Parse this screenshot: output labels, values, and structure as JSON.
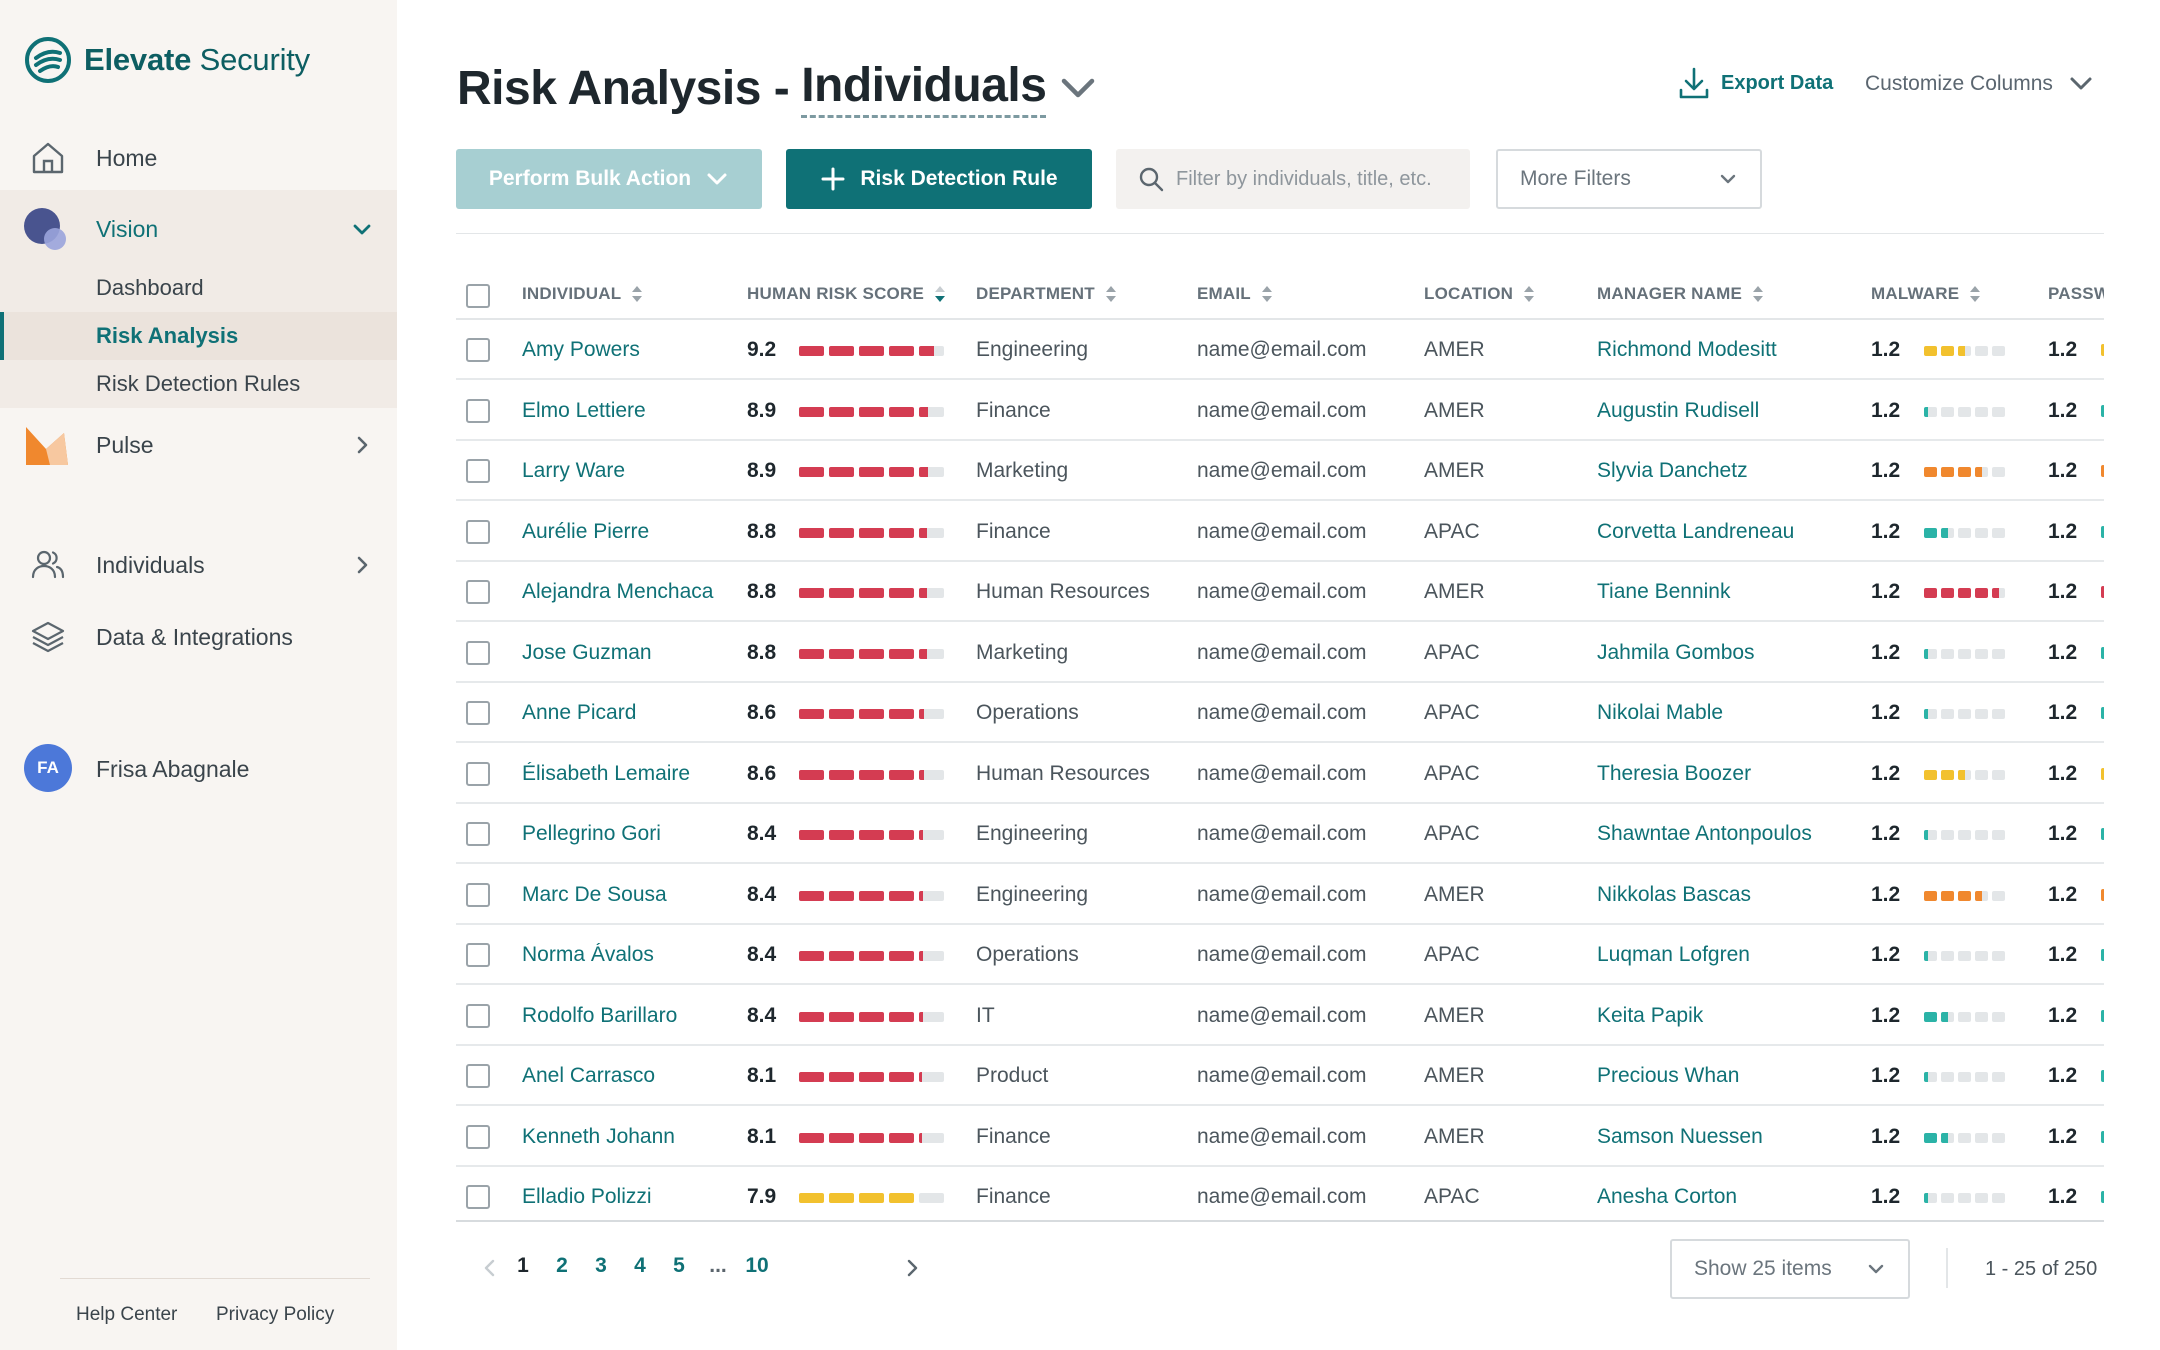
{
  "brand": {
    "name_bold": "Elevate",
    "name_light": " Security"
  },
  "nav": {
    "home": "Home",
    "vision": "Vision",
    "vision_sub": [
      "Dashboard",
      "Risk Analysis",
      "Risk Detection Rules"
    ],
    "pulse": "Pulse",
    "individuals": "Individuals",
    "data_integrations": "Data & Integrations"
  },
  "user": {
    "initials": "FA",
    "name": "Frisa Abagnale"
  },
  "footer": {
    "help": "Help Center",
    "privacy": "Privacy Policy"
  },
  "page": {
    "title_prefix": "Risk Analysis -",
    "title_selector": "Individuals"
  },
  "toolbar": {
    "export": "Export Data",
    "customize": "Customize Columns",
    "bulk": "Perform Bulk Action",
    "rule": "Risk Detection Rule",
    "search_placeholder": "Filter by individuals, title, etc.",
    "more_filters": "More Filters"
  },
  "colors": {
    "accent": "#0f7176",
    "risk_red": "#d43c52",
    "risk_yellow": "#f2c12e",
    "orange": "#f0882e",
    "teal": "#2bb3a7",
    "track": "#e3e6e8"
  },
  "table": {
    "columns": [
      "INDIVIDUAL",
      "HUMAN RISK SCORE",
      "DEPARTMENT",
      "EMAIL",
      "LOCATION",
      "MANAGER NAME",
      "MALWARE",
      "PASSW"
    ],
    "rows": [
      {
        "name": "Amy Powers",
        "score": "9.2",
        "risk": 0.92,
        "dept": "Engineering",
        "email": "name@email.com",
        "loc": "AMER",
        "mgr": "Richmond Modesitt",
        "mal": "1.2",
        "mal_level": 0.5,
        "mal_color": "yellow",
        "pw": "1.2"
      },
      {
        "name": "Elmo Lettiere",
        "score": "8.9",
        "risk": 0.87,
        "dept": "Finance",
        "email": "name@email.com",
        "loc": "AMER",
        "mgr": "Augustin Rudisell",
        "mal": "1.2",
        "mal_level": 0.06,
        "mal_color": "teal",
        "pw": "1.2"
      },
      {
        "name": "Larry Ware",
        "score": "8.9",
        "risk": 0.87,
        "dept": "Marketing",
        "email": "name@email.com",
        "loc": "AMER",
        "mgr": "Slyvia Danchetz",
        "mal": "1.2",
        "mal_level": 0.7,
        "mal_color": "orange",
        "pw": "1.2"
      },
      {
        "name": "Aurélie Pierre",
        "score": "8.8",
        "risk": 0.86,
        "dept": "Finance",
        "email": "name@email.com",
        "loc": "APAC",
        "mgr": "Corvetta Landreneau",
        "mal": "1.2",
        "mal_level": 0.3,
        "mal_color": "teal",
        "pw": "1.2"
      },
      {
        "name": "Alejandra Menchaca",
        "score": "8.8",
        "risk": 0.86,
        "dept": "Human Resources",
        "email": "name@email.com",
        "loc": "AMER",
        "mgr": "Tiane Bennink",
        "mal": "1.2",
        "mal_level": 0.9,
        "mal_color": "red",
        "pw": "1.2"
      },
      {
        "name": "Jose Guzman",
        "score": "8.8",
        "risk": 0.86,
        "dept": "Marketing",
        "email": "name@email.com",
        "loc": "APAC",
        "mgr": "Jahmila Gombos",
        "mal": "1.2",
        "mal_level": 0.06,
        "mal_color": "teal",
        "pw": "1.2"
      },
      {
        "name": "Anne Picard",
        "score": "8.6",
        "risk": 0.84,
        "dept": "Operations",
        "email": "name@email.com",
        "loc": "APAC",
        "mgr": "Nikolai Mable",
        "mal": "1.2",
        "mal_level": 0.06,
        "mal_color": "teal",
        "pw": "1.2"
      },
      {
        "name": "Élisabeth Lemaire",
        "score": "8.6",
        "risk": 0.84,
        "dept": "Human Resources",
        "email": "name@email.com",
        "loc": "APAC",
        "mgr": "Theresia Boozer",
        "mal": "1.2",
        "mal_level": 0.5,
        "mal_color": "yellow",
        "pw": "1.2"
      },
      {
        "name": "Pellegrino Gori",
        "score": "8.4",
        "risk": 0.83,
        "dept": "Engineering",
        "email": "name@email.com",
        "loc": "APAC",
        "mgr": "Shawntae Antonpoulos",
        "mal": "1.2",
        "mal_level": 0.06,
        "mal_color": "teal",
        "pw": "1.2"
      },
      {
        "name": "Marc De Sousa",
        "score": "8.4",
        "risk": 0.83,
        "dept": "Engineering",
        "email": "name@email.com",
        "loc": "AMER",
        "mgr": "Nikkolas Bascas",
        "mal": "1.2",
        "mal_level": 0.7,
        "mal_color": "orange",
        "pw": "1.2"
      },
      {
        "name": "Norma Ávalos",
        "score": "8.4",
        "risk": 0.83,
        "dept": "Operations",
        "email": "name@email.com",
        "loc": "APAC",
        "mgr": "Luqman Lofgren",
        "mal": "1.2",
        "mal_level": 0.06,
        "mal_color": "teal",
        "pw": "1.2"
      },
      {
        "name": "Rodolfo Barillaro",
        "score": "8.4",
        "risk": 0.83,
        "dept": "IT",
        "email": "name@email.com",
        "loc": "AMER",
        "mgr": "Keita Papik",
        "mal": "1.2",
        "mal_level": 0.3,
        "mal_color": "teal",
        "pw": "1.2"
      },
      {
        "name": "Anel Carrasco",
        "score": "8.1",
        "risk": 0.82,
        "dept": "Product",
        "email": "name@email.com",
        "loc": "AMER",
        "mgr": "Precious Whan",
        "mal": "1.2",
        "mal_level": 0.06,
        "mal_color": "teal",
        "pw": "1.2"
      },
      {
        "name": "Kenneth Johann",
        "score": "8.1",
        "risk": 0.82,
        "dept": "Finance",
        "email": "name@email.com",
        "loc": "AMER",
        "mgr": "Samson Nuessen",
        "mal": "1.2",
        "mal_level": 0.3,
        "mal_color": "teal",
        "pw": "1.2"
      },
      {
        "name": "Elladio Polizzi",
        "score": "7.9",
        "risk": 0.8,
        "dept": "Finance",
        "email": "name@email.com",
        "loc": "APAC",
        "mgr": "Anesha Corton",
        "mal": "1.2",
        "mal_level": 0.06,
        "mal_color": "teal",
        "pw": "1.2"
      }
    ]
  },
  "pagination": {
    "pages": [
      "1",
      "2",
      "3",
      "4",
      "5",
      "...",
      "10"
    ],
    "current": "1",
    "show_items": "Show 25 items",
    "range": "1 - 25 of 250"
  }
}
